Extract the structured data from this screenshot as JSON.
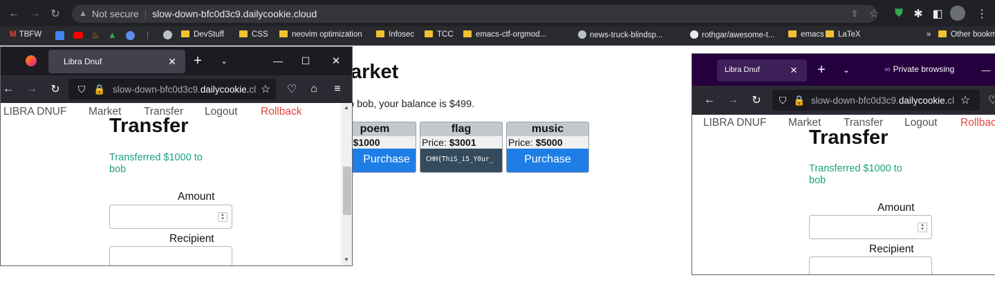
{
  "chrome": {
    "url_prefix": "Not secure",
    "url_host": "slow-down-bfc0d3c9.dailycookie.cloud",
    "bookmarks": [
      {
        "label": "TBFW"
      },
      {
        "label": "DevStuff"
      },
      {
        "label": "CSS"
      },
      {
        "label": "neovim optimization"
      },
      {
        "label": "Infosec"
      },
      {
        "label": "TCC"
      },
      {
        "label": "emacs-ctf-orgmod..."
      },
      {
        "label": "news-truck-blindsp..."
      },
      {
        "label": "rothgar/awesome-t..."
      },
      {
        "label": "emacs"
      },
      {
        "label": "LaTeX"
      }
    ],
    "overflow": "»",
    "other_bookmarks": "Other bookmarks"
  },
  "market": {
    "title": "arket",
    "welcome": "o bob, your balance is $499.",
    "items": [
      {
        "name": "poem",
        "price_label": "e: ",
        "price": "$1000",
        "button": "Purchase"
      },
      {
        "name": "flag",
        "price_label": "Price: ",
        "price": "$3001",
        "flag_text": "CHH{ThiS_i5_Y0ur_"
      },
      {
        "name": "music",
        "price_label": "Price: ",
        "price": "$5000",
        "button": "Purchase"
      }
    ]
  },
  "ff_left": {
    "tab_title": "Libra Dnuf",
    "url_host": "slow-down-bfc0d3c9.",
    "url_domain": "dailycookie.",
    "url_tail": "cl",
    "nav": {
      "brand": "LIBRA DNUF",
      "market": "Market",
      "transfer": "Transfer",
      "logout": "Logout",
      "rollback": "Rollback"
    },
    "title": "Transfer",
    "message": "Transferred $1000 to bob",
    "amount_label": "Amount",
    "recipient_label": "Recipient"
  },
  "ff_right": {
    "tab_title": "Libra Dnuf",
    "private_label": "Private browsing",
    "url_host": "slow-down-bfc0d3c9.",
    "url_domain": "dailycookie.",
    "url_tail": "cl",
    "nav": {
      "brand": "LIBRA DNUF",
      "market": "Market",
      "transfer": "Transfer",
      "logout": "Logout",
      "rollback": "Rollbac"
    },
    "title": "Transfer",
    "message": "Transferred $1000 to bob",
    "amount_label": "Amount",
    "recipient_label": "Recipient"
  },
  "colors": {
    "accent": "#1e7ee6",
    "success": "#1aa07f",
    "danger": "#e3443b",
    "private": "#25003e"
  }
}
